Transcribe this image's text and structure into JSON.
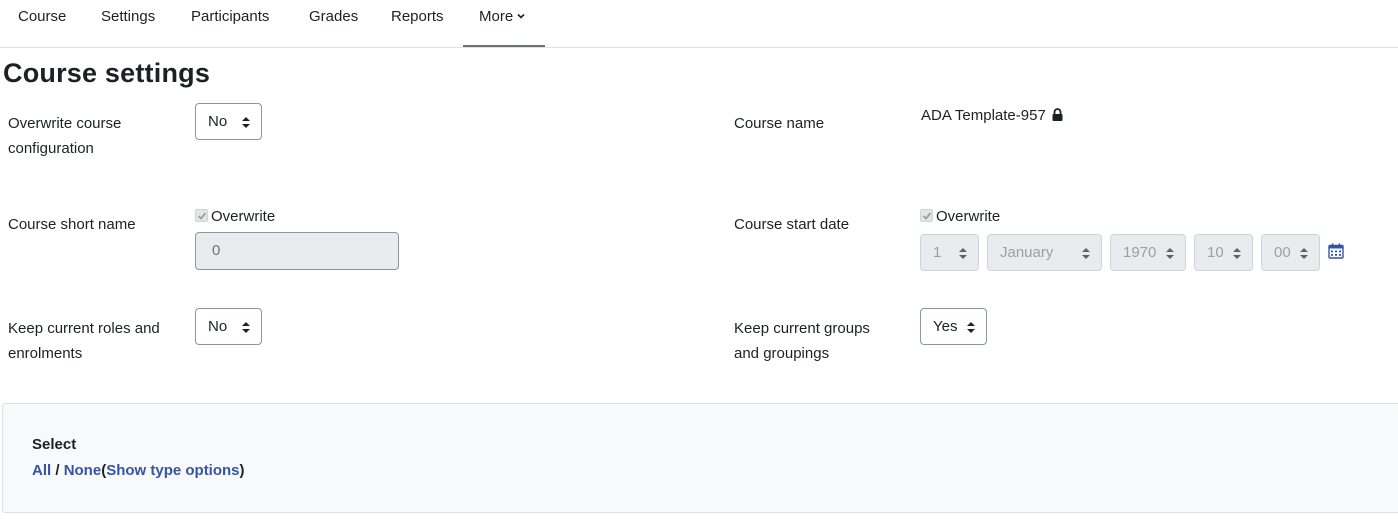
{
  "nav": {
    "items": [
      "Course",
      "Settings",
      "Participants",
      "Grades",
      "Reports"
    ],
    "more_label": "More"
  },
  "page_title": "Course settings",
  "form": {
    "overwrite_config": {
      "label_line1": "Overwrite course",
      "label_line2": "configuration",
      "value": "No"
    },
    "course_name": {
      "label": "Course name",
      "value": "ADA Template-957"
    },
    "short_name": {
      "label": "Course short name",
      "overwrite_label": "Overwrite",
      "overwrite_checked": true,
      "value": "0"
    },
    "start_date": {
      "label": "Course start date",
      "overwrite_label": "Overwrite",
      "overwrite_checked": true,
      "day": "1",
      "month": "January",
      "year": "1970",
      "hour": "10",
      "minute": "00"
    },
    "keep_roles": {
      "label_line1": "Keep current roles and",
      "label_line2": "enrolments",
      "value": "No"
    },
    "keep_groups": {
      "label_line1": "Keep current groups",
      "label_line2": "and groupings",
      "value": "Yes"
    }
  },
  "select_section": {
    "title": "Select",
    "all": "All",
    "separator": "/",
    "none": "None",
    "open_paren": "(",
    "show_type_options": "Show type options",
    "close_paren": ")"
  },
  "icons": {
    "lock": "lock-icon",
    "calendar": "calendar-icon",
    "chevron": "chevron-down-icon",
    "select_arrows": "sort-arrows-icon"
  },
  "colors": {
    "link": "#3554a4",
    "calendar": "#3554a4",
    "text": "#1d2125",
    "section_bg": "#f8f9fa",
    "disabled_bg": "#e9ecef"
  }
}
